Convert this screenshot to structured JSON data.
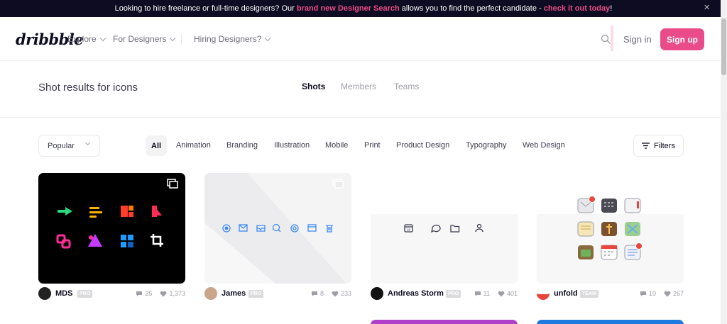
{
  "announcement": {
    "text_before": "Looking to hire freelance or full-time designers? Our ",
    "link1": "brand new Designer Search",
    "text_middle": " allows you to find the perfect candidate - ",
    "link2": "check it out today",
    "text_after": "!",
    "close": "×"
  },
  "nav": {
    "logo": "dribbble",
    "explore": "Explore",
    "for_designers": "For Designers",
    "hiring": "Hiring Designers?",
    "sign_in": "Sign in",
    "sign_up": "Sign up"
  },
  "results": {
    "title": "Shot results for icons",
    "tabs": [
      "Shots",
      "Members",
      "Teams"
    ]
  },
  "filters": {
    "sort": "Popular",
    "categories": [
      "All",
      "Animation",
      "Branding",
      "Illustration",
      "Mobile",
      "Print",
      "Product Design",
      "Typography",
      "Web Design"
    ],
    "filters_label": "Filters"
  },
  "shots": [
    {
      "user": "MDS",
      "badge": "PRO",
      "comments": "25",
      "likes": "1,373"
    },
    {
      "user": "James",
      "badge": "PRO",
      "comments": "8",
      "likes": "233"
    },
    {
      "user": "Andreas Storm",
      "badge": "PRO",
      "comments": "11",
      "likes": "401"
    },
    {
      "user": "unfold",
      "badge": "TEAM",
      "comments": "10",
      "likes": "267"
    }
  ],
  "colors": {
    "accent": "#ea4c89",
    "dark": "#0d0c22",
    "blue_icons": "#3d8bf2"
  },
  "icons": [
    "search-icon",
    "close-icon",
    "filters-icon",
    "comment-icon",
    "heart-icon",
    "multi-shot-icon"
  ]
}
